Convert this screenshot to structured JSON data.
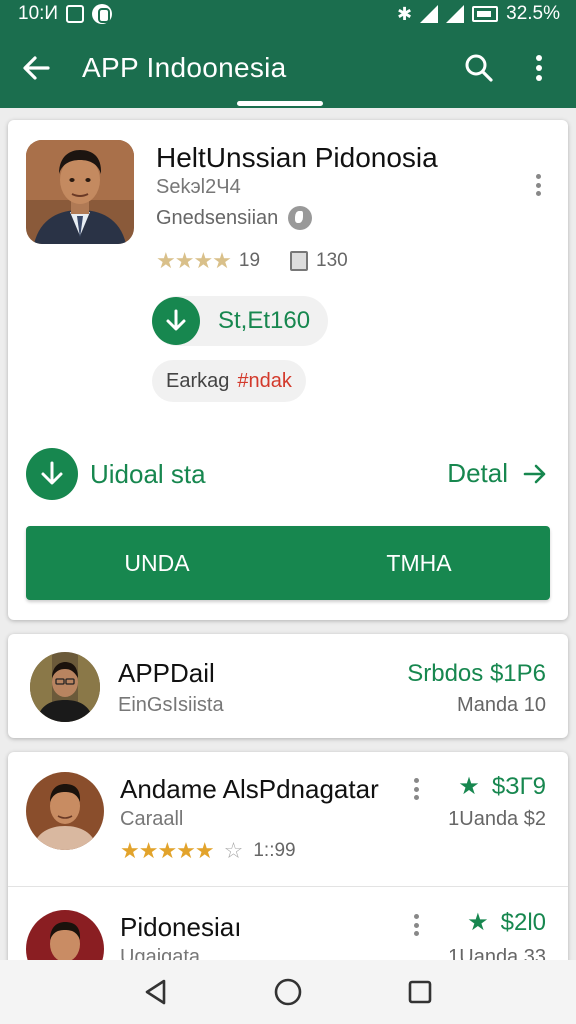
{
  "status_bar": {
    "time": "10:И",
    "battery_text": "32.5%"
  },
  "app_bar": {
    "title": "APP Indoonesia",
    "back_icon": "arrow-left-icon",
    "search_icon": "search-icon",
    "menu_icon": "more-vert-icon"
  },
  "colors": {
    "primary": "#1b6e4e",
    "accent": "#17874f",
    "tag_red": "#d33a2c",
    "star_gold": "#e2a32b"
  },
  "main_card": {
    "title": "HeltUnssian Pidonosia",
    "subtitle": "Sekэl2Ч4",
    "publisher": "Gnedsensiian",
    "rating_value": "19",
    "review_count": "130",
    "size_label": "St,Et160",
    "tag_label_a": "Earkag",
    "tag_label_b": "#ndak",
    "download_label": "Uidoal sta",
    "detail_label": "Detal",
    "button_left": "UNDA",
    "button_right": "TMHA"
  },
  "list": [
    {
      "title": "APPDail",
      "subtitle": "EinGsIsiista",
      "price": "Srbdos $1P6",
      "right_sub": "Manda 10"
    },
    {
      "title": "Andame AlsPdnagatar",
      "subtitle": "Caraall",
      "price": "$ЗГ9",
      "right_sub": "1Uanda $2",
      "rating_text": "1::99"
    },
    {
      "title": "Pidonesiaı",
      "subtitle": "Ugaigata",
      "price": "$2l0",
      "right_sub": "1Uanda 33"
    }
  ],
  "nav": {
    "back": "nav-back-icon",
    "home": "nav-home-icon",
    "recent": "nav-recent-icon"
  }
}
